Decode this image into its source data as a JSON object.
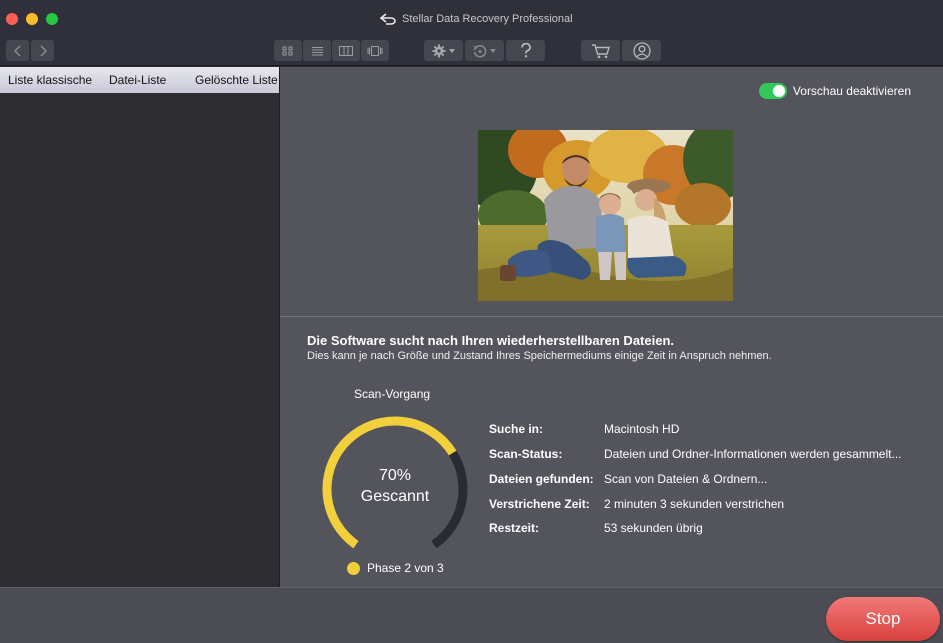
{
  "window": {
    "title": "Stellar Data Recovery Professional"
  },
  "toolbar": {
    "nav": [
      "back-icon",
      "forward-icon"
    ],
    "views": [
      "grid-view-icon",
      "list-view-icon",
      "column-view-icon",
      "cover-flow-icon"
    ],
    "actions": [
      "gear-icon",
      "history-icon",
      "help-icon"
    ],
    "account": [
      "cart-icon",
      "user-icon"
    ]
  },
  "left_pane": {
    "tabs": [
      "Liste klassische",
      "Datei-Liste",
      "Gelöschte Liste"
    ]
  },
  "preview": {
    "toggle_label": "Vorschau deaktivieren",
    "toggle_on": true
  },
  "scan": {
    "heading": "Die Software sucht nach Ihren wiederherstellbaren Dateien.",
    "subheading": "Dies kann je nach Größe und Zustand Ihres Speichermediums einige Zeit in Anspruch nehmen.",
    "gauge_title": "Scan-Vorgang",
    "percent_label": "70%",
    "percent_value": 0.7,
    "scanned_label": "Gescannt",
    "phase_label": "Phase 2 von 3",
    "details": [
      {
        "label": "Suche in:",
        "value": "Macintosh HD"
      },
      {
        "label": "Scan-Status:",
        "value": "Dateien und Ordner-Informationen werden gesammelt..."
      },
      {
        "label": "Dateien gefunden:",
        "value": "Scan von Dateien & Ordnern..."
      },
      {
        "label": "Verstrichene Zeit:",
        "value": "2 minuten 3 sekunden verstrichen"
      },
      {
        "label": "Restzeit:",
        "value": "53 sekunden übrig"
      }
    ]
  },
  "footer": {
    "stop_label": "Stop"
  },
  "colors": {
    "gauge_fill": "#f2d03b",
    "gauge_track": "#2a2a33",
    "stop_button": "#e45855",
    "toggle": "#34c759"
  }
}
